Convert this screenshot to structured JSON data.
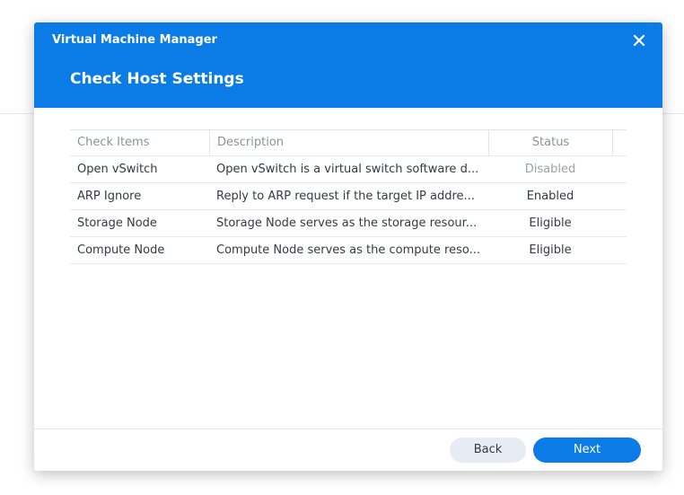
{
  "window": {
    "title": "Virtual Machine Manager",
    "heading": "Check Host Settings",
    "close_icon": "close-icon"
  },
  "table": {
    "columns": [
      "Check Items",
      "Description",
      "Status"
    ],
    "rows": [
      {
        "item": "Open vSwitch",
        "description": "Open vSwitch is a virtual switch software d...",
        "status": "Disabled"
      },
      {
        "item": "ARP Ignore",
        "description": "Reply to ARP request if the target IP addre...",
        "status": "Enabled"
      },
      {
        "item": "Storage Node",
        "description": "Storage Node serves as the storage resour...",
        "status": "Eligible"
      },
      {
        "item": "Compute Node",
        "description": "Compute Node serves as the compute reso...",
        "status": "Eligible"
      }
    ]
  },
  "footer": {
    "back_label": "Back",
    "next_label": "Next"
  },
  "colors": {
    "accent": "#0b7ce6",
    "disabled_text": "#9aa1a8"
  }
}
